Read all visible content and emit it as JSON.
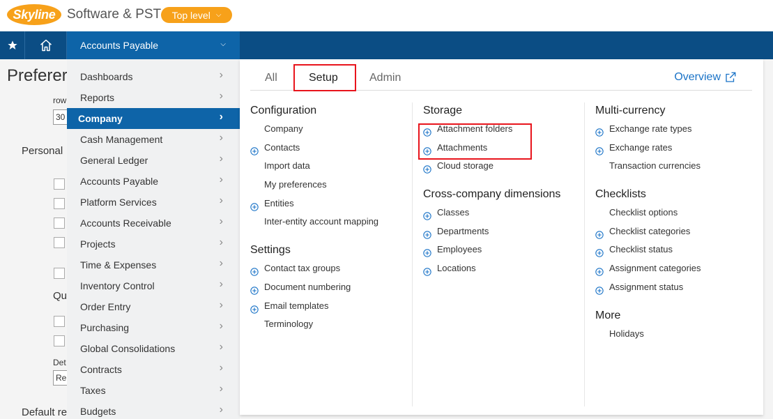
{
  "header": {
    "logo_text": "Skyline",
    "company": "Software & PST",
    "level": "Top level"
  },
  "nav": {
    "module": "Accounts Payable"
  },
  "background_page": {
    "title": "Preferer",
    "row_label": "row",
    "row_value": "30",
    "personal": "Personal",
    "qu": "Qu",
    "det": "Det",
    "re": "Re",
    "default": "Default re"
  },
  "left_menu": {
    "items": [
      {
        "label": "Dashboards",
        "active": false
      },
      {
        "label": "Reports",
        "active": false
      },
      {
        "label": "Company",
        "active": true
      },
      {
        "label": "Cash Management",
        "active": false
      },
      {
        "label": "General Ledger",
        "active": false
      },
      {
        "label": "Accounts Payable",
        "active": false
      },
      {
        "label": "Platform Services",
        "active": false
      },
      {
        "label": "Accounts Receivable",
        "active": false
      },
      {
        "label": "Projects",
        "active": false
      },
      {
        "label": "Time & Expenses",
        "active": false
      },
      {
        "label": "Inventory Control",
        "active": false
      },
      {
        "label": "Order Entry",
        "active": false
      },
      {
        "label": "Purchasing",
        "active": false
      },
      {
        "label": "Global Consolidations",
        "active": false
      },
      {
        "label": "Contracts",
        "active": false
      },
      {
        "label": "Taxes",
        "active": false
      },
      {
        "label": "Budgets",
        "active": false
      }
    ]
  },
  "panel": {
    "tabs": [
      {
        "label": "All"
      },
      {
        "label": "Setup"
      },
      {
        "label": "Admin"
      }
    ],
    "active_tab": "Setup",
    "overview": "Overview",
    "columns": [
      {
        "sections": [
          {
            "heading": "Configuration",
            "links": [
              {
                "label": "Company",
                "plus": false
              },
              {
                "label": "Contacts",
                "plus": true
              },
              {
                "label": "Import data",
                "plus": false
              },
              {
                "label": "My preferences",
                "plus": false
              },
              {
                "label": "Entities",
                "plus": true
              },
              {
                "label": "Inter-entity account mapping",
                "plus": false
              }
            ]
          },
          {
            "heading": "Settings",
            "links": [
              {
                "label": "Contact tax groups",
                "plus": true
              },
              {
                "label": "Document numbering",
                "plus": true
              },
              {
                "label": "Email templates",
                "plus": true
              },
              {
                "label": "Terminology",
                "plus": false
              }
            ]
          }
        ]
      },
      {
        "sections": [
          {
            "heading": "Storage",
            "links": [
              {
                "label": "Attachment folders",
                "plus": true
              },
              {
                "label": "Attachments",
                "plus": true
              },
              {
                "label": "Cloud storage",
                "plus": true
              }
            ]
          },
          {
            "heading": "Cross-company dimensions",
            "links": [
              {
                "label": "Classes",
                "plus": true
              },
              {
                "label": "Departments",
                "plus": true
              },
              {
                "label": "Employees",
                "plus": true
              },
              {
                "label": "Locations",
                "plus": true
              }
            ]
          }
        ]
      },
      {
        "sections": [
          {
            "heading": "Multi-currency",
            "links": [
              {
                "label": "Exchange rate types",
                "plus": true
              },
              {
                "label": "Exchange rates",
                "plus": true
              },
              {
                "label": "Transaction currencies",
                "plus": false
              }
            ]
          },
          {
            "heading": "Checklists",
            "links": [
              {
                "label": "Checklist options",
                "plus": false
              },
              {
                "label": "Checklist categories",
                "plus": true
              },
              {
                "label": "Checklist status",
                "plus": true
              },
              {
                "label": "Assignment categories",
                "plus": true
              },
              {
                "label": "Assignment status",
                "plus": true
              }
            ]
          },
          {
            "heading": "More",
            "links": [
              {
                "label": "Holidays",
                "plus": false
              }
            ]
          }
        ]
      }
    ]
  },
  "colors": {
    "brand_orange": "#f7a11a",
    "nav_blue": "#0b4d84",
    "active_blue": "#0e64a8",
    "link_blue": "#1a73c7",
    "highlight_red": "#e8141c"
  }
}
